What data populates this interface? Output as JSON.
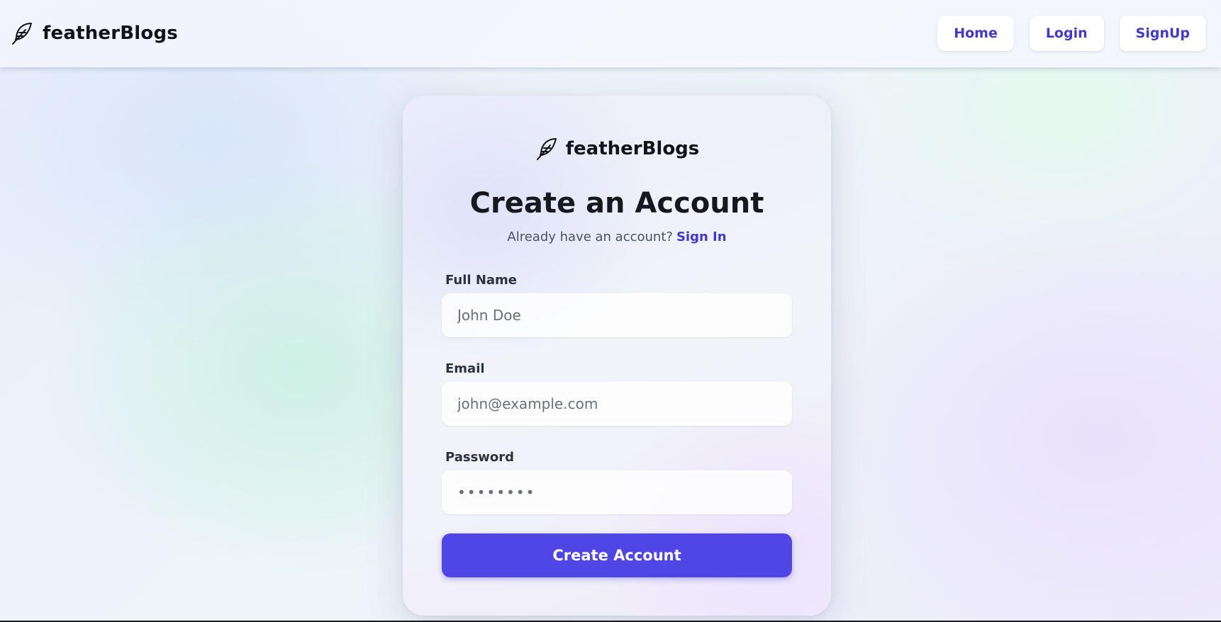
{
  "header": {
    "brand_name": "featherBlogs",
    "brand_icon": "feather-icon",
    "nav": {
      "home": "Home",
      "login": "Login",
      "signup": "SignUp"
    }
  },
  "card": {
    "brand_name": "featherBlogs",
    "brand_icon": "feather-icon",
    "title": "Create an Account",
    "subtitle_text": "Already have an account?",
    "subtitle_link": "Sign In",
    "fields": {
      "full_name": {
        "label": "Full Name",
        "placeholder": "John Doe"
      },
      "email": {
        "label": "Email",
        "placeholder": "john@example.com"
      },
      "password": {
        "label": "Password",
        "placeholder": "••••••••"
      }
    },
    "submit_label": "Create Account"
  },
  "colors": {
    "accent": "#4f46e5",
    "link": "#4338ca",
    "text_dark": "#16181d"
  }
}
